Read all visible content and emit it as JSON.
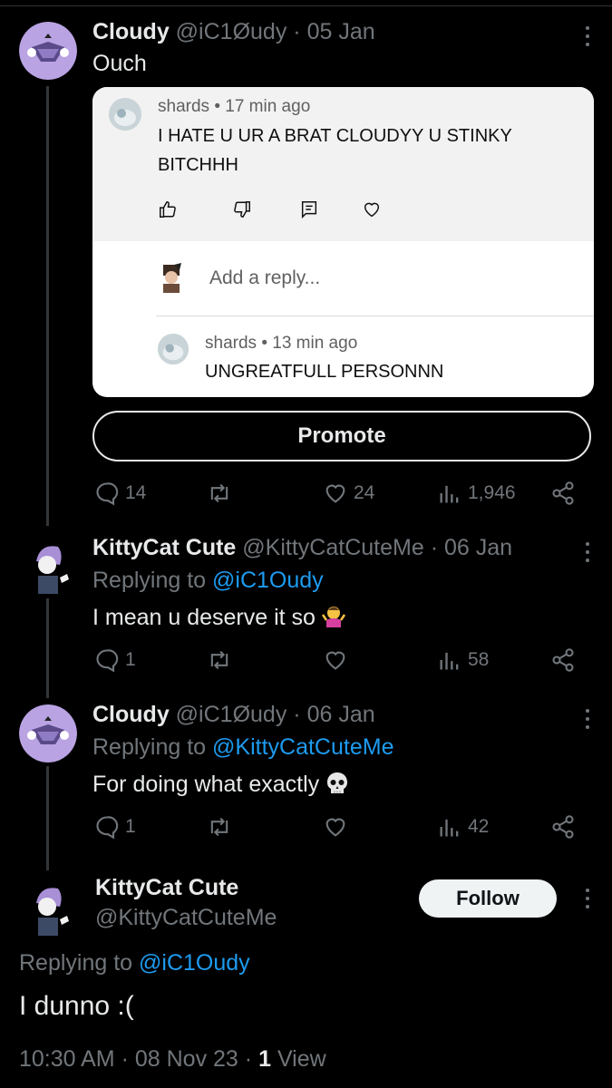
{
  "post1": {
    "name": "Cloudy",
    "handle": "@iC1Øudy",
    "date": "05 Jan",
    "text": "Ouch",
    "embed": {
      "comment1": {
        "author": "shards",
        "time": "17 min ago",
        "text_line1": "I HATE U UR A BRAT CLOUDYY U STINKY",
        "text_line2": "BITCHHH"
      },
      "reply_placeholder": "Add a reply...",
      "comment2": {
        "author": "shards",
        "time": "13 min ago",
        "text": "UNGREATFULL PERSONNN"
      }
    },
    "promote_label": "Promote",
    "replies": "14",
    "likes": "24",
    "views": "1,946"
  },
  "post2": {
    "name": "KittyCat Cute",
    "handle": "@KittyCatCuteMe",
    "date": "06 Jan",
    "replying_prefix": "Replying to",
    "replying_to": "@iC1Oudy",
    "text": "I mean u deserve it so",
    "replies": "1",
    "views": "58"
  },
  "post3": {
    "name": "Cloudy",
    "handle": "@iC1Øudy",
    "date": "06 Jan",
    "replying_prefix": "Replying to",
    "replying_to": "@KittyCatCuteMe",
    "text": "For doing what exactly",
    "replies": "1",
    "views": "42"
  },
  "main": {
    "name": "KittyCat Cute",
    "handle": "@KittyCatCuteMe",
    "follow_label": "Follow",
    "replying_prefix": "Replying to",
    "replying_to": "@iC1Oudy",
    "text": "I dunno :(",
    "time": "10:30 AM",
    "date": "08 Nov 23",
    "view_count": "1",
    "view_label": "View"
  },
  "colors": {
    "background": "#000000",
    "text": "#e7e9ea",
    "muted": "#71767b",
    "link": "#1d9bf0",
    "avatar_cloudy": "#b9a3e3"
  },
  "icons": [
    "reply-icon",
    "retweet-icon",
    "like-icon",
    "views-icon",
    "share-icon",
    "more-icon",
    "thumbs-up-icon",
    "thumbs-down-icon",
    "comment-icon",
    "heart-icon"
  ]
}
